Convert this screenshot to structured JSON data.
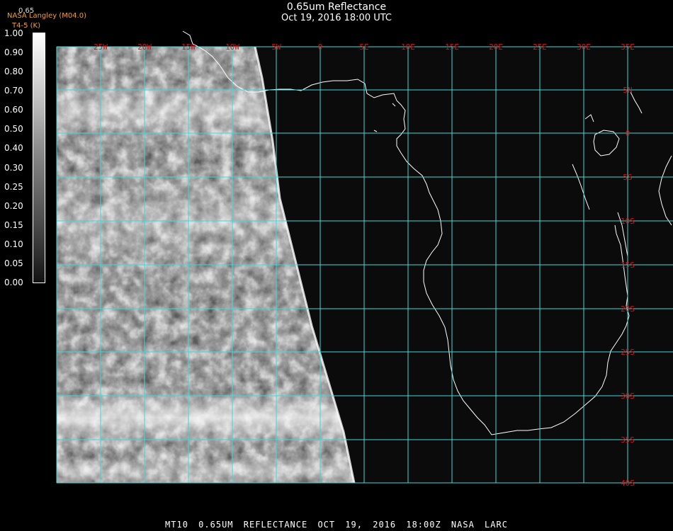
{
  "header": {
    "title": "0.65um Reflectance",
    "subtitle": "Oct 19, 2016 18:00 UTC",
    "credit": "NASA Langley (M04.0)",
    "credit_sub": "T4-5 (K)",
    "legend_value": "0.65"
  },
  "colorbar": {
    "ticks": [
      "1.00",
      "0.90",
      "0.80",
      "0.70",
      "0.60",
      "0.50",
      "0.40",
      "0.30",
      "0.25",
      "0.20",
      "0.15",
      "0.10",
      "0.05",
      "0.00"
    ]
  },
  "map": {
    "lon_labels": [
      "25W",
      "20W",
      "15W",
      "10W",
      "5W",
      "0",
      "5E",
      "10E",
      "15E",
      "20E",
      "25E",
      "30E",
      "35E"
    ],
    "lat_labels": [
      "5N",
      "0",
      "5S",
      "10S",
      "15S",
      "20S",
      "25S",
      "30S",
      "35S",
      "40S"
    ],
    "grid_color": "#40d8d8",
    "label_color": "#d01818",
    "coast_color": "#ffffff"
  },
  "footer": {
    "text": "MT10 0.65UM REFLECTANCE OCT 19, 2016 18:00Z NASA LARC"
  }
}
